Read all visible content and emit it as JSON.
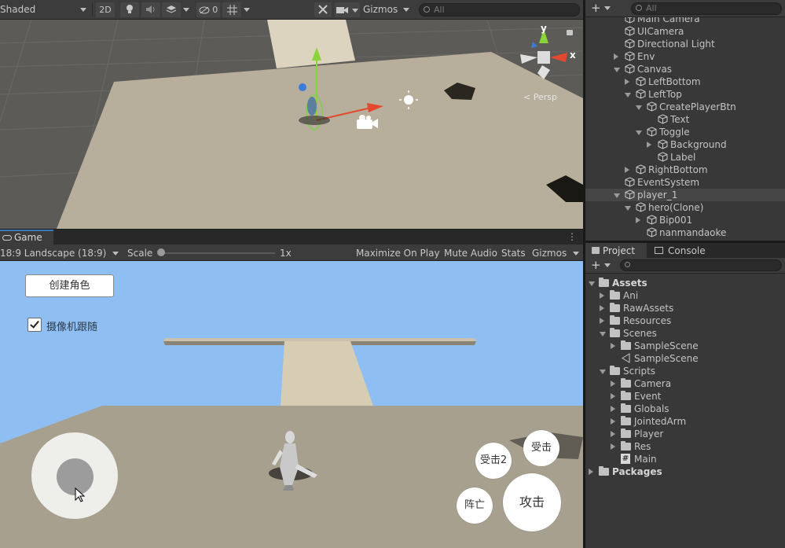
{
  "scene_toolbar": {
    "shading_mode": "Shaded",
    "mode_2d": "2D",
    "hidden_count": "0",
    "gizmos": "Gizmos",
    "search_placeholder": "All"
  },
  "scene_view": {
    "projection": "Persp",
    "gizmo_axes": {
      "y": "y",
      "x": "x"
    },
    "colors": {
      "ground": "#b5ac9a",
      "sky": "#5d5b58",
      "axis_y": "#8ad43b",
      "axis_x": "#e2492f",
      "axis_z": "#3b7bdb"
    }
  },
  "game_tab": {
    "label": "Game"
  },
  "game_toolbar": {
    "aspect": "18:9 Landscape (18:9)",
    "scale_label": "Scale",
    "scale_value": "1x",
    "scale_fraction": 0.0,
    "maximize": "Maximize On Play",
    "mute": "Mute Audio",
    "stats": "Stats",
    "gizmos": "Gizmos"
  },
  "game_view": {
    "create_button": "创建角色",
    "follow_camera_label": "摄像机跟随",
    "follow_camera_checked": true,
    "buttons": {
      "hit2": "受击2",
      "hit": "受击",
      "death": "阵亡",
      "attack": "攻击"
    },
    "colors": {
      "sky": "#8fbff2",
      "ground": "#a7a08f",
      "platform": "#d6ccb4"
    }
  },
  "hierarchy": {
    "search_placeholder": "All",
    "items": [
      {
        "label": "Main Camera",
        "depth": 0,
        "arrow": "none"
      },
      {
        "label": "UICamera",
        "depth": 0,
        "arrow": "none"
      },
      {
        "label": "Directional Light",
        "depth": 0,
        "arrow": "none"
      },
      {
        "label": "Env",
        "depth": 0,
        "arrow": "right"
      },
      {
        "label": "Canvas",
        "depth": 0,
        "arrow": "down"
      },
      {
        "label": "LeftBottom",
        "depth": 1,
        "arrow": "right"
      },
      {
        "label": "LeftTop",
        "depth": 1,
        "arrow": "down"
      },
      {
        "label": "CreatePlayerBtn",
        "depth": 2,
        "arrow": "down"
      },
      {
        "label": "Text",
        "depth": 3,
        "arrow": "none"
      },
      {
        "label": "Toggle",
        "depth": 2,
        "arrow": "down"
      },
      {
        "label": "Background",
        "depth": 3,
        "arrow": "right"
      },
      {
        "label": "Label",
        "depth": 3,
        "arrow": "none"
      },
      {
        "label": "RightBottom",
        "depth": 1,
        "arrow": "right"
      },
      {
        "label": "EventSystem",
        "depth": 0,
        "arrow": "none"
      },
      {
        "label": "player_1",
        "depth": 0,
        "arrow": "down",
        "selected": true
      },
      {
        "label": "hero(Clone)",
        "depth": 1,
        "arrow": "down"
      },
      {
        "label": "Bip001",
        "depth": 2,
        "arrow": "right"
      },
      {
        "label": "nanmandaoke",
        "depth": 2,
        "arrow": "none"
      }
    ]
  },
  "project_tabs": {
    "project": "Project",
    "console": "Console"
  },
  "project": {
    "items": [
      {
        "label": "Assets",
        "depth": 0,
        "arrow": "down",
        "icon": "folder",
        "bold": true
      },
      {
        "label": "Ani",
        "depth": 1,
        "arrow": "right",
        "icon": "folder"
      },
      {
        "label": "RawAssets",
        "depth": 1,
        "arrow": "right",
        "icon": "folder"
      },
      {
        "label": "Resources",
        "depth": 1,
        "arrow": "right",
        "icon": "folder"
      },
      {
        "label": "Scenes",
        "depth": 1,
        "arrow": "down",
        "icon": "folder"
      },
      {
        "label": "SampleScene",
        "depth": 2,
        "arrow": "right",
        "icon": "folder"
      },
      {
        "label": "SampleScene",
        "depth": 2,
        "arrow": "none",
        "icon": "scene"
      },
      {
        "label": "Scripts",
        "depth": 1,
        "arrow": "down",
        "icon": "folder"
      },
      {
        "label": "Camera",
        "depth": 2,
        "arrow": "right",
        "icon": "folder"
      },
      {
        "label": "Event",
        "depth": 2,
        "arrow": "right",
        "icon": "folder"
      },
      {
        "label": "Globals",
        "depth": 2,
        "arrow": "right",
        "icon": "folder"
      },
      {
        "label": "JointedArm",
        "depth": 2,
        "arrow": "right",
        "icon": "folder"
      },
      {
        "label": "Player",
        "depth": 2,
        "arrow": "right",
        "icon": "folder"
      },
      {
        "label": "Res",
        "depth": 2,
        "arrow": "right",
        "icon": "folder"
      },
      {
        "label": "Main",
        "depth": 2,
        "arrow": "none",
        "icon": "script"
      },
      {
        "label": "Packages",
        "depth": 0,
        "arrow": "right",
        "icon": "folder",
        "bold": true
      }
    ]
  }
}
